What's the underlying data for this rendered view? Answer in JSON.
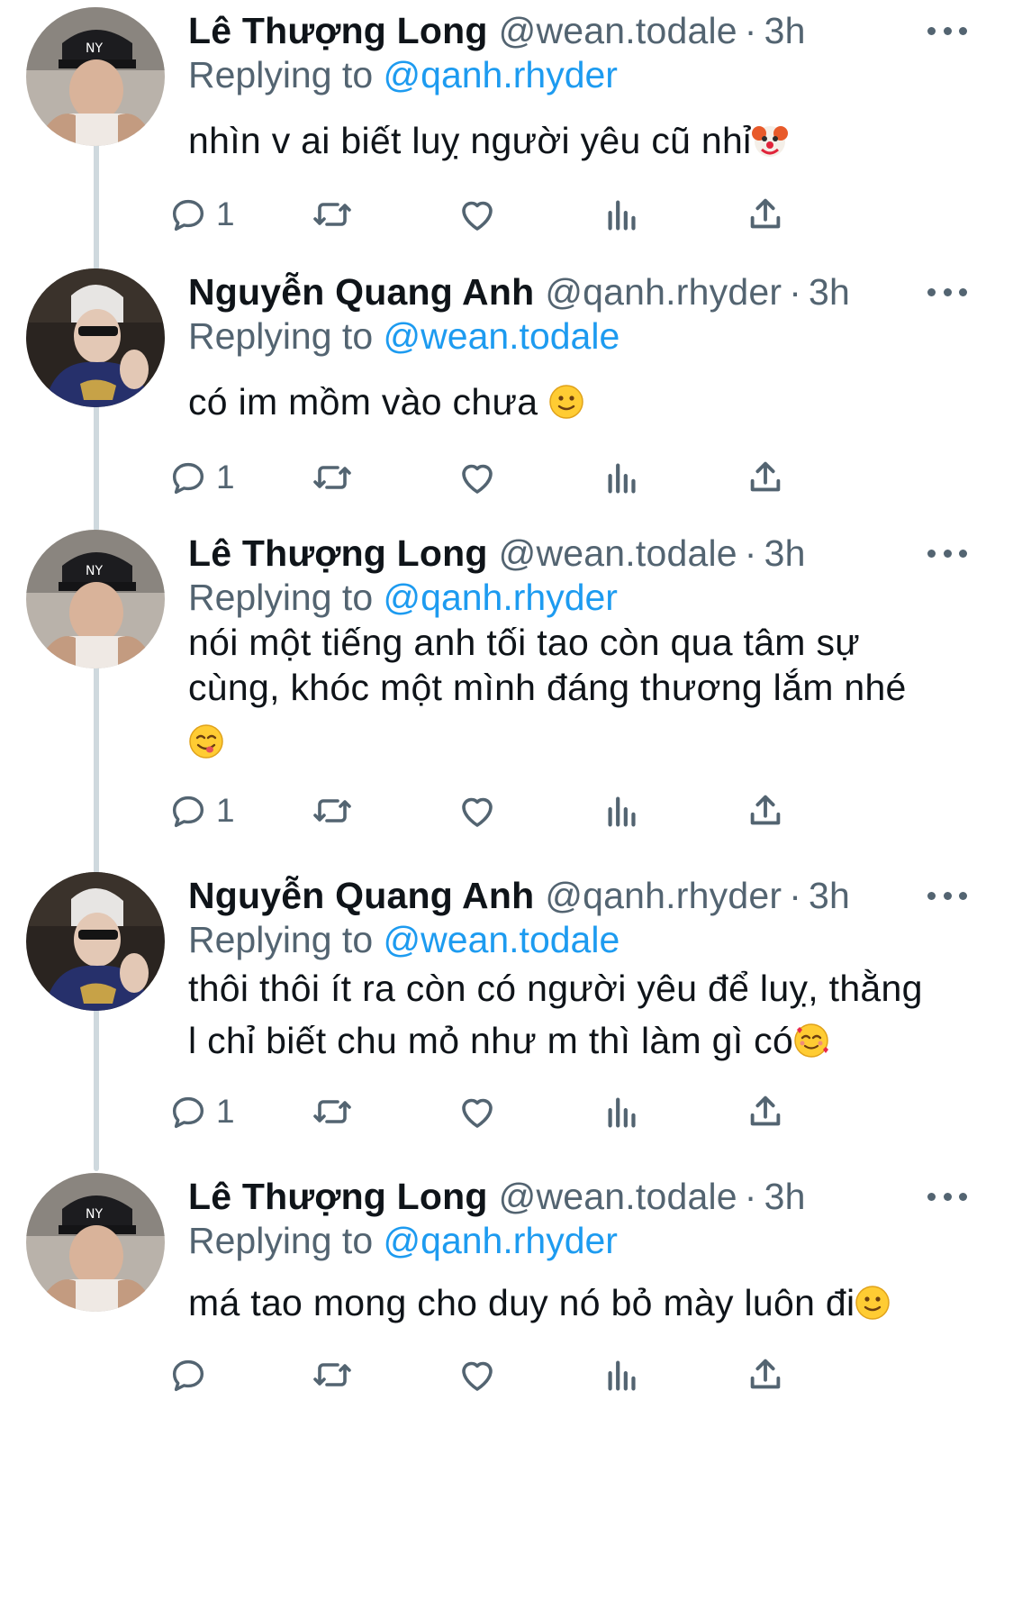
{
  "colors": {
    "link": "#1d9bf0",
    "secondary_text": "#536471",
    "primary_text": "#0f1419",
    "thread_line": "#cfd9de"
  },
  "icons": {
    "more": "more-dots-icon",
    "reply": "reply-bubble-icon",
    "retweet": "retweet-icon",
    "like": "heart-icon",
    "views": "bar-chart-icon",
    "share": "share-icon"
  },
  "tweets": [
    {
      "display_name": "Lê Thượng Long",
      "handle": "@wean.todale",
      "dot": "·",
      "time": "3h",
      "replying_prefix": "Replying to",
      "replying_to": "@qanh.rhyder",
      "text": "nhìn v ai biết luỵ người yêu cũ nhỉ",
      "emoji": "clown-face-emoji",
      "reply_count": "1"
    },
    {
      "display_name": "Nguyễn Quang Anh",
      "handle": "@qanh.rhyder",
      "dot": "·",
      "time": "3h",
      "replying_prefix": "Replying to",
      "replying_to": "@wean.todale",
      "text": "có im mồm vào chưa ",
      "emoji": "slightly-smiling-face-emoji",
      "reply_count": "1"
    },
    {
      "display_name": "Lê Thượng Long",
      "handle": "@wean.todale",
      "dot": "·",
      "time": "3h",
      "replying_prefix": "Replying to",
      "replying_to": "@qanh.rhyder",
      "text_lines": [
        "nói một tiếng anh tối tao còn qua tâm sự",
        "cùng, khóc một mình đáng thương lắm nhé"
      ],
      "emoji": "face-savoring-food-emoji",
      "reply_count": "1"
    },
    {
      "display_name": "Nguyễn Quang Anh",
      "handle": "@qanh.rhyder",
      "dot": "·",
      "time": "3h",
      "replying_prefix": "Replying to",
      "replying_to": "@wean.todale",
      "text_lines": [
        "thôi thôi ít ra còn có người yêu để luỵ, thằng",
        "l chỉ biết chu mỏ như m thì làm gì có"
      ],
      "emoji": "smiling-face-with-hearts-emoji",
      "reply_count": "1"
    },
    {
      "display_name": "Lê Thượng Long",
      "handle": "@wean.todale",
      "dot": "·",
      "time": "3h",
      "replying_prefix": "Replying to",
      "replying_to": "@qanh.rhyder",
      "text": "má tao mong cho duy nó bỏ mày luôn đi",
      "emoji": "slightly-smiling-face-emoji",
      "reply_count": ""
    }
  ]
}
